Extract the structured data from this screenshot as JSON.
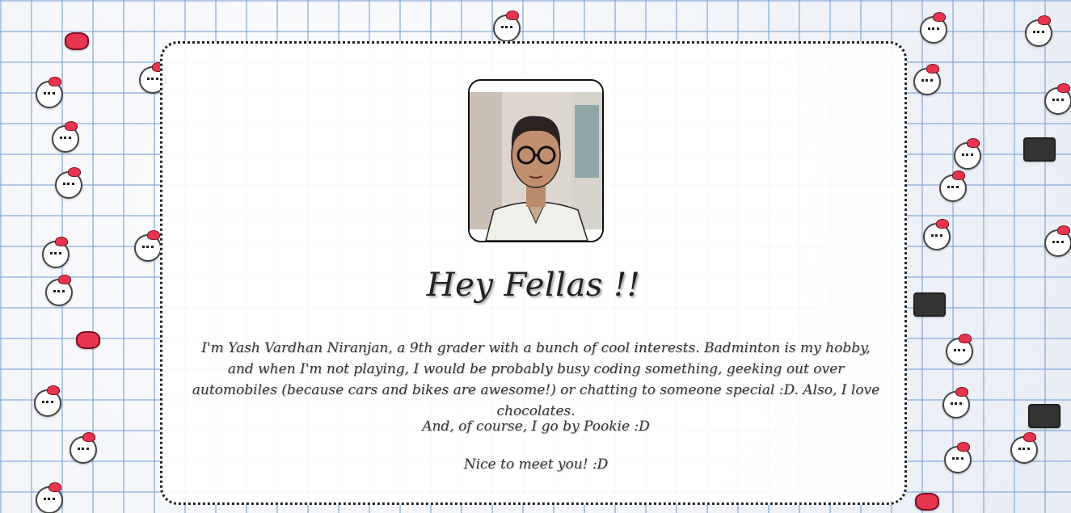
{
  "profile": {
    "image_alt": "profile photo",
    "heading": "Hey Fellas !!",
    "intro": "I'm Yash Vardhan Niranjan, a 9th grader with a bunch of cool interests. Badminton is my hobby, and when I'm not playing, I would be probably busy coding something, geeking out over automobiles (because cars and bikes are awesome!) or chatting to someone special :D. Also, I love chocolates.",
    "nickname_line": "And, of course, I go by Pookie :D",
    "greeting": "Nice to meet you! :D"
  },
  "background": {
    "pattern": "blue grid paper with hello-kitty stickers",
    "sticker_icon": "hello-kitty-icon",
    "bow_icon": "bow-icon",
    "grid_color": "#78a0d7",
    "bow_color": "#e8354f"
  }
}
